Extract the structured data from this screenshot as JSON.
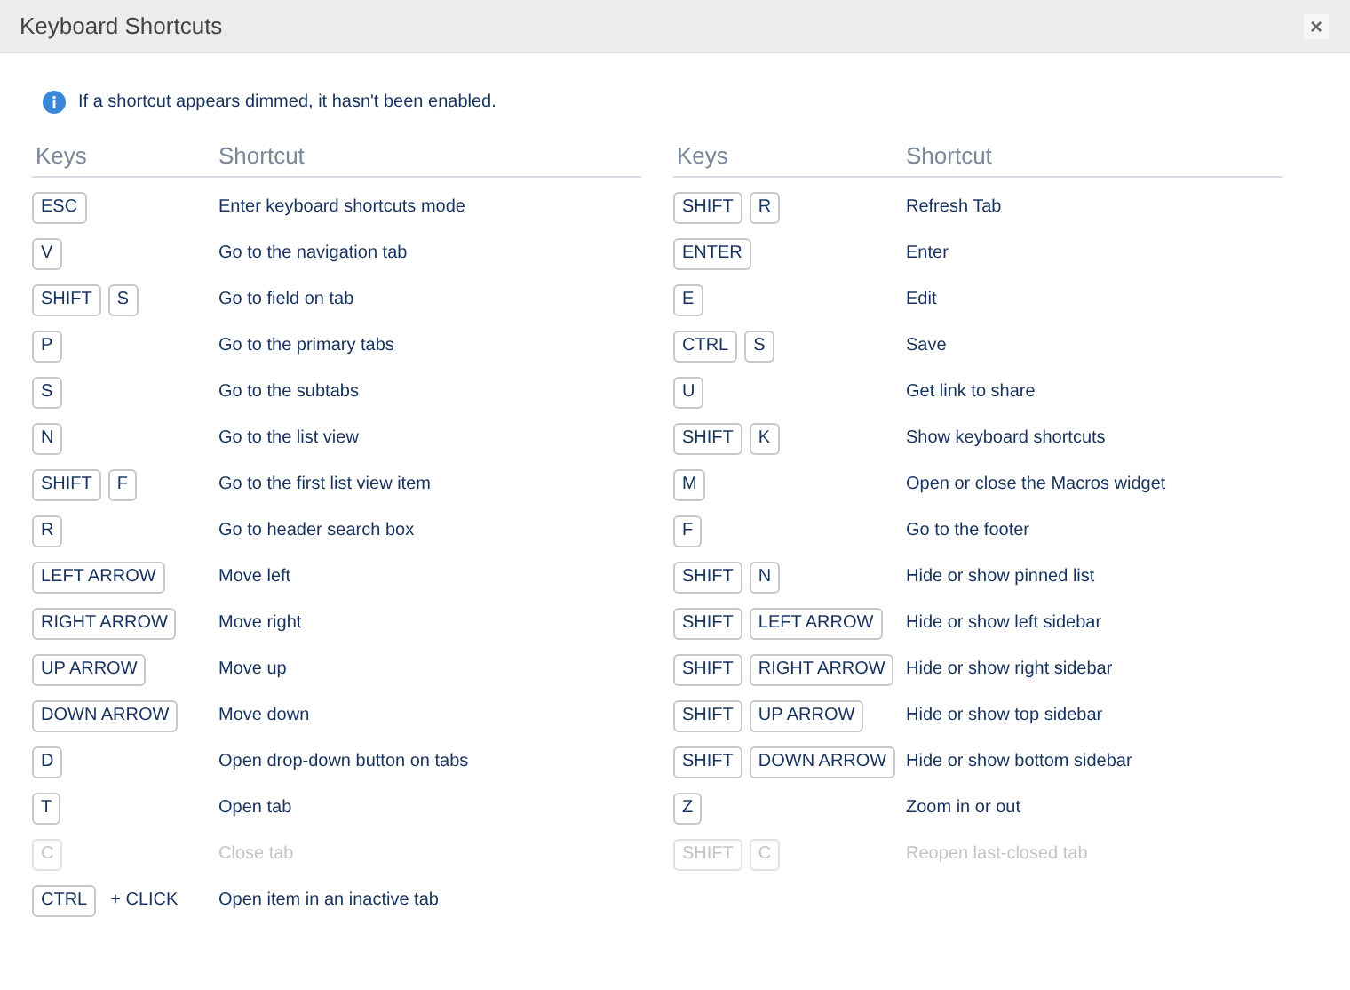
{
  "window": {
    "title": "Keyboard Shortcuts",
    "close": "×"
  },
  "notice": "If a shortcut appears dimmed, it hasn't been enabled.",
  "columns": [
    {
      "headers": [
        "Keys",
        "Shortcut"
      ],
      "rows": [
        {
          "keys": [
            {
              "kind": "key",
              "text": "ESC"
            }
          ],
          "action": "Enter keyboard shortcuts mode",
          "enabled": true
        },
        {
          "keys": [
            {
              "kind": "key",
              "text": "V"
            }
          ],
          "action": "Go to the navigation tab",
          "enabled": true
        },
        {
          "keys": [
            {
              "kind": "key",
              "text": "SHIFT"
            },
            {
              "kind": "key",
              "text": "S"
            }
          ],
          "action": "Go to field on tab",
          "enabled": true
        },
        {
          "keys": [
            {
              "kind": "key",
              "text": "P"
            }
          ],
          "action": "Go to the primary tabs",
          "enabled": true
        },
        {
          "keys": [
            {
              "kind": "key",
              "text": "S"
            }
          ],
          "action": "Go to the subtabs",
          "enabled": true
        },
        {
          "keys": [
            {
              "kind": "key",
              "text": "N"
            }
          ],
          "action": "Go to the list view",
          "enabled": true
        },
        {
          "keys": [
            {
              "kind": "key",
              "text": "SHIFT"
            },
            {
              "kind": "key",
              "text": "F"
            }
          ],
          "action": "Go to the first list view item",
          "enabled": true
        },
        {
          "keys": [
            {
              "kind": "key",
              "text": "R"
            }
          ],
          "action": "Go to header search box",
          "enabled": true
        },
        {
          "keys": [
            {
              "kind": "key",
              "text": "LEFT ARROW"
            }
          ],
          "action": "Move left",
          "enabled": true
        },
        {
          "keys": [
            {
              "kind": "key",
              "text": "RIGHT ARROW"
            }
          ],
          "action": "Move right",
          "enabled": true
        },
        {
          "keys": [
            {
              "kind": "key",
              "text": "UP ARROW"
            }
          ],
          "action": "Move up",
          "enabled": true
        },
        {
          "keys": [
            {
              "kind": "key",
              "text": "DOWN ARROW"
            }
          ],
          "action": "Move down",
          "enabled": true
        },
        {
          "keys": [
            {
              "kind": "key",
              "text": "D"
            }
          ],
          "action": "Open drop-down button on tabs",
          "enabled": true
        },
        {
          "keys": [
            {
              "kind": "key",
              "text": "T"
            }
          ],
          "action": "Open tab",
          "enabled": true
        },
        {
          "keys": [
            {
              "kind": "key",
              "text": "C"
            }
          ],
          "action": "Close tab",
          "enabled": false
        },
        {
          "keys": [
            {
              "kind": "key",
              "text": "CTRL"
            },
            {
              "kind": "text",
              "text": "+ CLICK"
            }
          ],
          "action": "Open item in an inactive tab",
          "enabled": true
        }
      ]
    },
    {
      "headers": [
        "Keys",
        "Shortcut"
      ],
      "rows": [
        {
          "keys": [
            {
              "kind": "key",
              "text": "SHIFT"
            },
            {
              "kind": "key",
              "text": "R"
            }
          ],
          "action": "Refresh Tab",
          "enabled": true
        },
        {
          "keys": [
            {
              "kind": "key",
              "text": "ENTER"
            }
          ],
          "action": "Enter",
          "enabled": true
        },
        {
          "keys": [
            {
              "kind": "key",
              "text": "E"
            }
          ],
          "action": "Edit",
          "enabled": true
        },
        {
          "keys": [
            {
              "kind": "key",
              "text": "CTRL"
            },
            {
              "kind": "key",
              "text": "S"
            }
          ],
          "action": "Save",
          "enabled": true
        },
        {
          "keys": [
            {
              "kind": "key",
              "text": "U"
            }
          ],
          "action": "Get link to share",
          "enabled": true
        },
        {
          "keys": [
            {
              "kind": "key",
              "text": "SHIFT"
            },
            {
              "kind": "key",
              "text": "K"
            }
          ],
          "action": "Show keyboard shortcuts",
          "enabled": true
        },
        {
          "keys": [
            {
              "kind": "key",
              "text": "M"
            }
          ],
          "action": "Open or close the Macros widget",
          "enabled": true
        },
        {
          "keys": [
            {
              "kind": "key",
              "text": "F"
            }
          ],
          "action": "Go to the footer",
          "enabled": true
        },
        {
          "keys": [
            {
              "kind": "key",
              "text": "SHIFT"
            },
            {
              "kind": "key",
              "text": "N"
            }
          ],
          "action": "Hide or show pinned list",
          "enabled": true
        },
        {
          "keys": [
            {
              "kind": "key",
              "text": "SHIFT"
            },
            {
              "kind": "key",
              "text": "LEFT ARROW"
            }
          ],
          "action": "Hide or show left sidebar",
          "enabled": true
        },
        {
          "keys": [
            {
              "kind": "key",
              "text": "SHIFT"
            },
            {
              "kind": "key",
              "text": "RIGHT ARROW"
            }
          ],
          "action": "Hide or show right sidebar",
          "enabled": true
        },
        {
          "keys": [
            {
              "kind": "key",
              "text": "SHIFT"
            },
            {
              "kind": "key",
              "text": "UP ARROW"
            }
          ],
          "action": "Hide or show top sidebar",
          "enabled": true
        },
        {
          "keys": [
            {
              "kind": "key",
              "text": "SHIFT"
            },
            {
              "kind": "key",
              "text": "DOWN ARROW"
            }
          ],
          "action": "Hide or show bottom sidebar",
          "enabled": true
        },
        {
          "keys": [
            {
              "kind": "key",
              "text": "Z"
            }
          ],
          "action": "Zoom in or out",
          "enabled": true
        },
        {
          "keys": [
            {
              "kind": "key",
              "text": "SHIFT"
            },
            {
              "kind": "key",
              "text": "C"
            }
          ],
          "action": "Reopen last-closed tab",
          "enabled": false
        }
      ]
    }
  ]
}
